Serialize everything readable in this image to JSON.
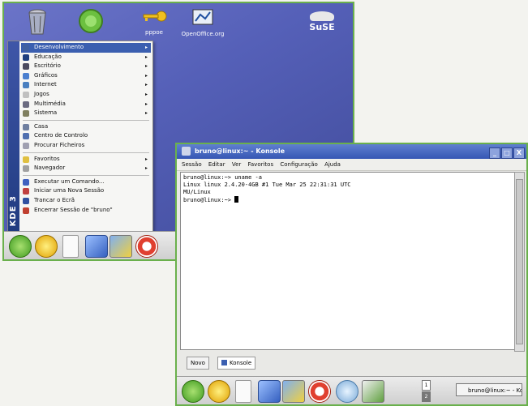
{
  "desktop": {
    "icons": [
      {
        "name": "trash-icon",
        "label": ""
      },
      {
        "name": "kde-ball-icon",
        "label": ""
      },
      {
        "name": "key-icon",
        "label": "pppoe"
      },
      {
        "name": "openoffice-icon",
        "label": "OpenOffice.org"
      }
    ],
    "logo_text": "SuSE",
    "side_brand": "KDE 3"
  },
  "kmenu": {
    "items": [
      {
        "label": "Desenvolvimento",
        "arrow": "▸",
        "color": "#4060a0"
      },
      {
        "label": "Educação",
        "arrow": "▸",
        "color": "#1f3f7f"
      },
      {
        "label": "Escritório",
        "arrow": "▸",
        "color": "#4a4a60"
      },
      {
        "label": "Gráficos",
        "arrow": "▸",
        "color": "#4a7fcf"
      },
      {
        "label": "Internet",
        "arrow": "▸",
        "color": "#4a80c0"
      },
      {
        "label": "Jogos",
        "arrow": "▸",
        "color": "#c0c0c0"
      },
      {
        "label": "Multimédia",
        "arrow": "▸",
        "color": "#6a6a80"
      },
      {
        "label": "Sistema",
        "arrow": "▸",
        "color": "#808060"
      },
      {
        "label": "Casa",
        "arrow": "",
        "color": "#7080a0"
      },
      {
        "label": "Centro de Controlo",
        "arrow": "",
        "color": "#5070b0"
      },
      {
        "label": "Procurar Ficheiros",
        "arrow": "",
        "color": "#a0a0b0"
      },
      {
        "label": "Favoritos",
        "arrow": "▸",
        "color": "#e0c040"
      },
      {
        "label": "Navegador",
        "arrow": "▸",
        "color": "#a0a0a0"
      },
      {
        "label": "Executar um Comando...",
        "arrow": "",
        "color": "#4060c0"
      },
      {
        "label": "Iniciar uma Nova Sessão",
        "arrow": "",
        "color": "#c04040"
      },
      {
        "label": "Trancar o Ecrã",
        "arrow": "",
        "color": "#3050a0"
      },
      {
        "label": "Encerrar Sessão de \"bruno\"",
        "arrow": "",
        "color": "#c04030"
      }
    ]
  },
  "konsole": {
    "title": "bruno@linux:~ - Konsole",
    "menu": [
      "Sessão",
      "Editar",
      "Ver",
      "Favoritos",
      "Configuração",
      "Ajuda"
    ],
    "window_buttons": [
      "_",
      "□",
      "X"
    ],
    "terminal_lines": [
      "bruno@linux:~> uname -a",
      "Linux linux 2.4.20-4GB #1 Tue Mar 25 22:31:31 UTC",
      "MU/Linux",
      "bruno@linux:~> "
    ],
    "tabs": {
      "new_label": "Novo",
      "session_label": "Konsole"
    },
    "taskbar": {
      "task_label": "bruno@linux:~ - Konsole",
      "pager": [
        "1",
        "2"
      ]
    }
  }
}
